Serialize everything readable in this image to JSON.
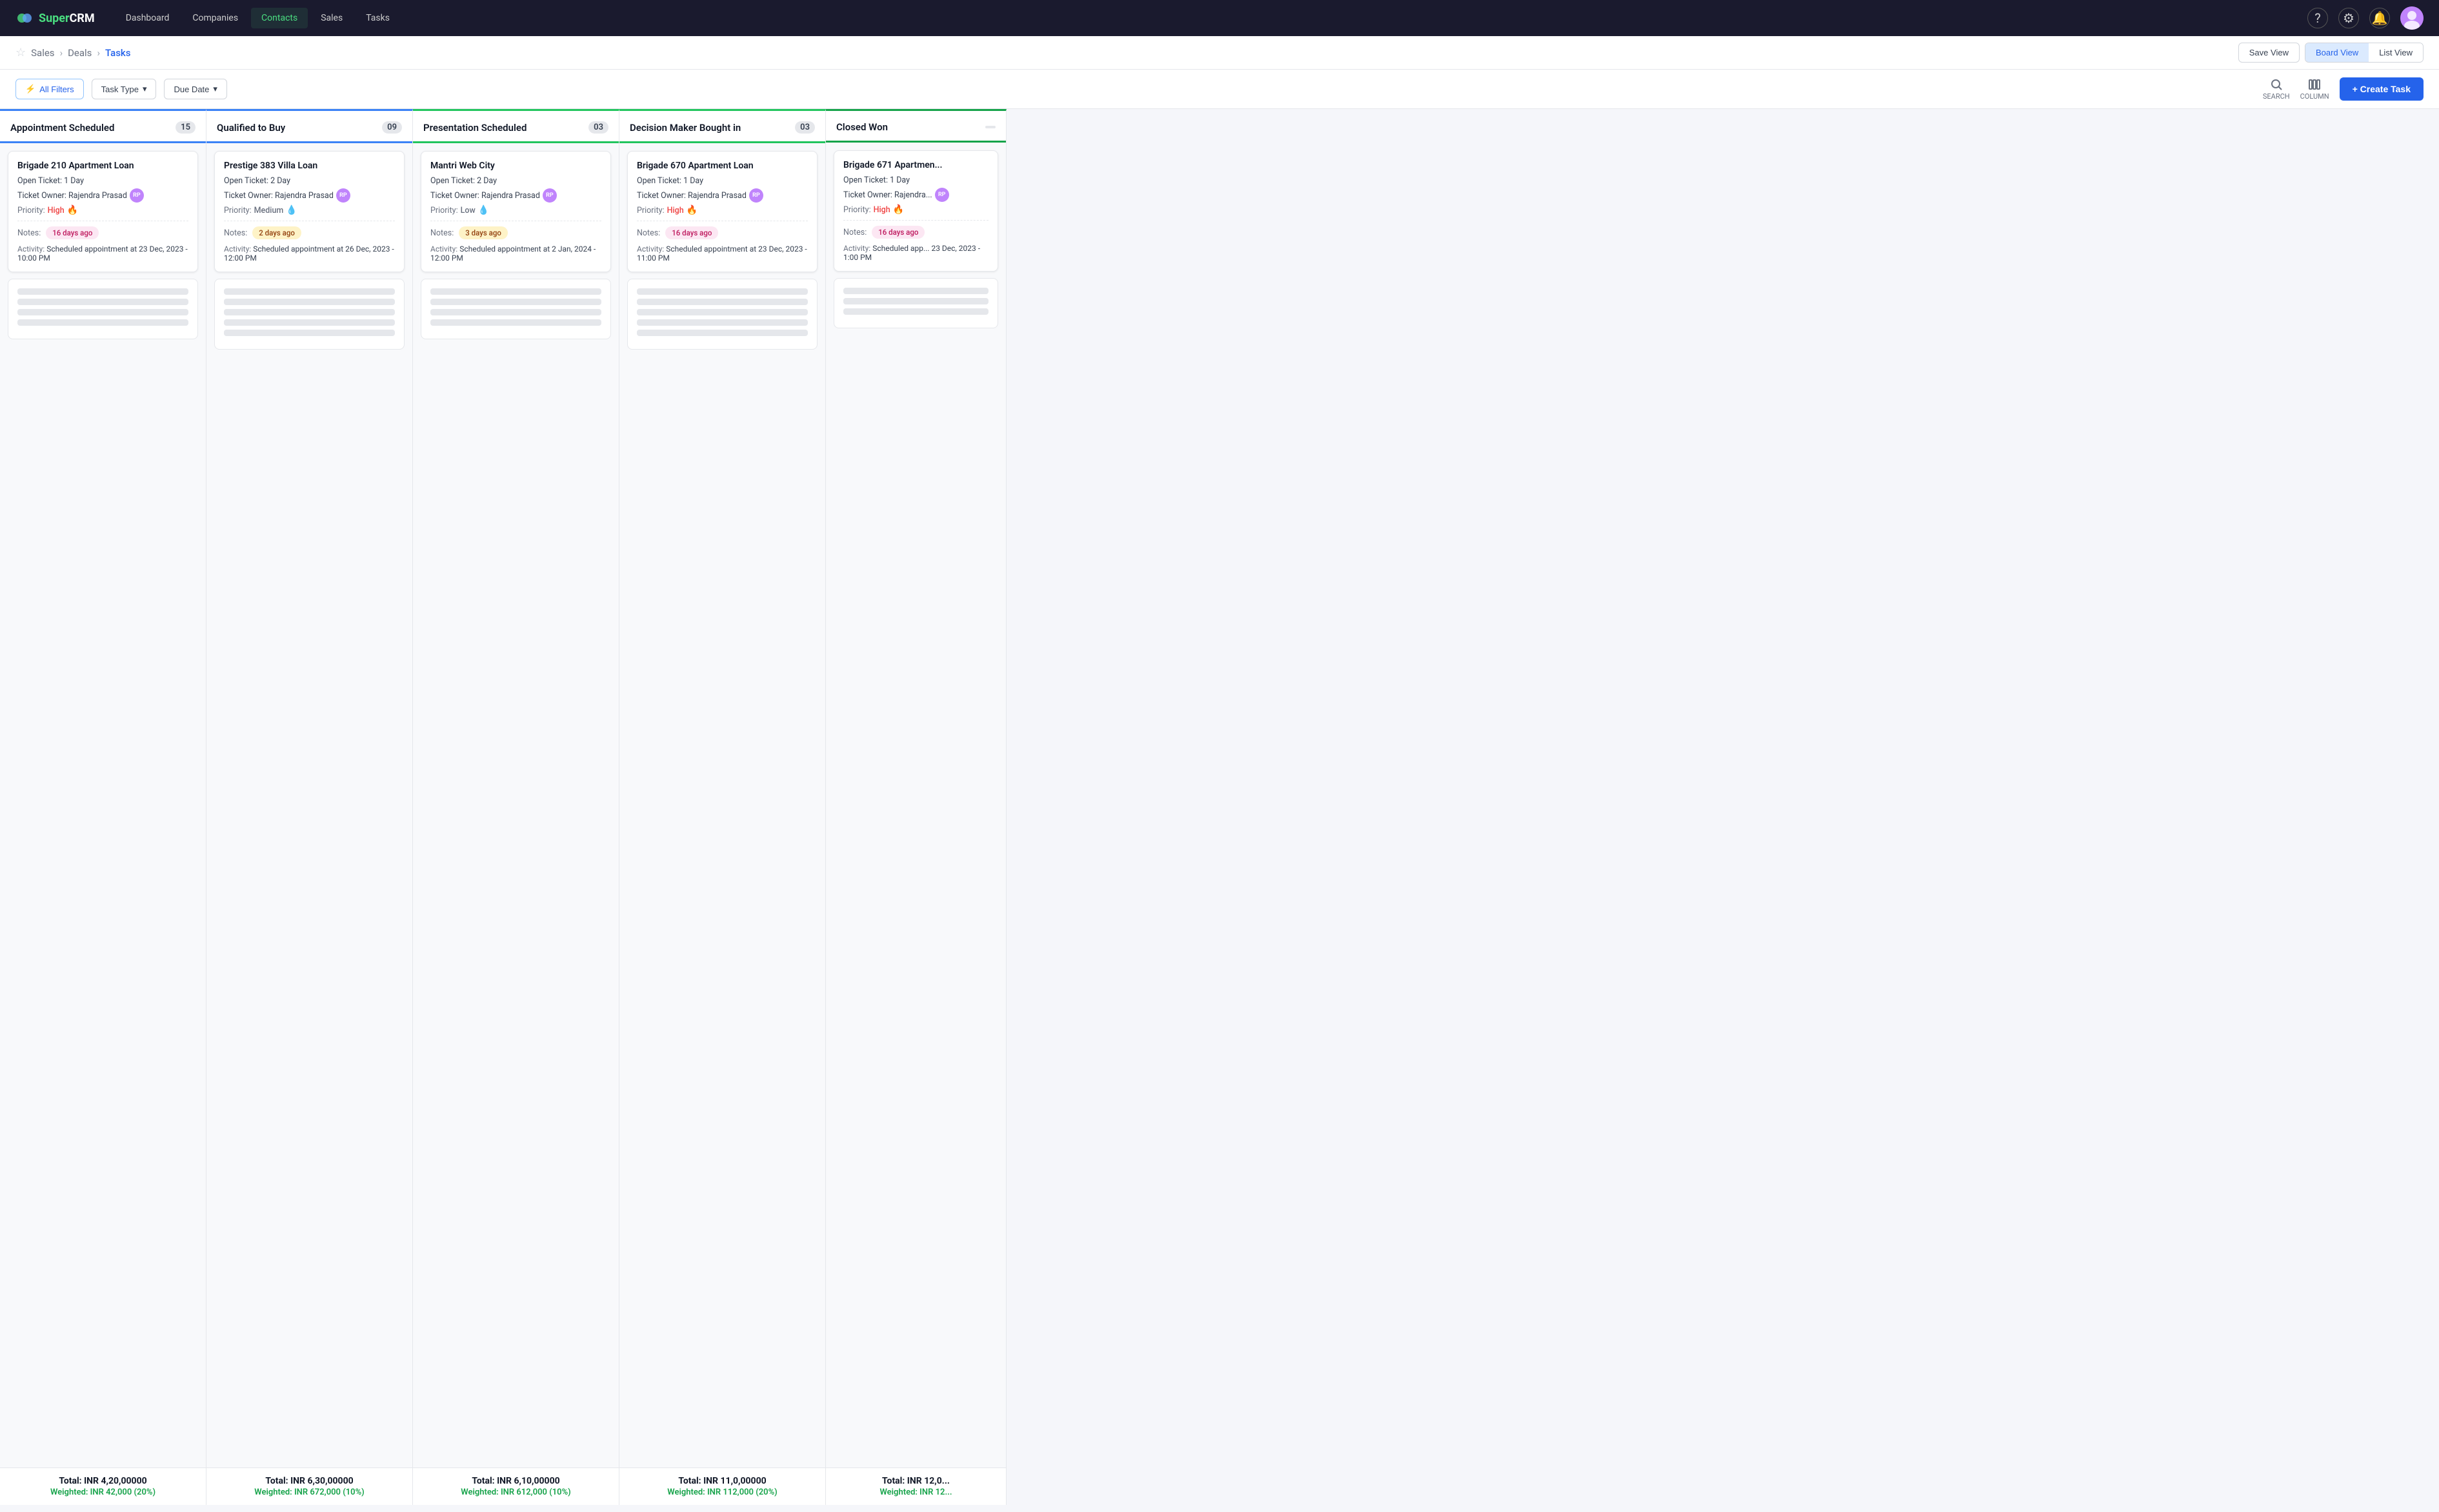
{
  "app": {
    "name": "SuperCRM",
    "logo_text_super": "Super",
    "logo_text_crm": "CRM"
  },
  "topnav": {
    "links": [
      {
        "label": "Dashboard",
        "active": false
      },
      {
        "label": "Companies",
        "active": false
      },
      {
        "label": "Contacts",
        "active": true
      },
      {
        "label": "Sales",
        "active": false
      },
      {
        "label": "Tasks",
        "active": false
      }
    ],
    "icons": {
      "help": "?",
      "settings": "⚙",
      "notifications": "🔔"
    }
  },
  "breadcrumb": {
    "star": "☆",
    "items": [
      {
        "label": "Sales",
        "active": false
      },
      {
        "label": "Deals",
        "active": false
      },
      {
        "label": "Tasks",
        "active": true
      }
    ]
  },
  "view_buttons": {
    "save_view": "Save View",
    "board_view": "Board View",
    "list_view": "List View"
  },
  "filters": {
    "all_filters": "All Filters",
    "task_type": "Task Type",
    "due_date": "Due Date",
    "search_label": "SEARCH",
    "column_label": "COLUMN",
    "create_task": "+ Create Task"
  },
  "columns": [
    {
      "id": "appointment-scheduled",
      "title": "Appointment Scheduled",
      "count": "15",
      "accent_color": "#3b82f6",
      "footer_total": "Total: INR 4,20,00000",
      "footer_weighted": "Weighted: INR 42,000 (20%)",
      "card": {
        "title": "Brigade 210 Apartment  Loan",
        "open_ticket": "Open Ticket: 1 Day",
        "owner": "Ticket Owner: Rajendra Prasad",
        "priority_label": "Priority:",
        "priority_value": "High",
        "priority_class": "high",
        "priority_emoji": "🔥",
        "notes_label": "Notes:",
        "notes_badge": "16 days ago",
        "notes_badge_class": "old",
        "activity_label": "Activity:",
        "activity_value": "Scheduled appointment at 23 Dec, 2023 - 10:00 PM"
      }
    },
    {
      "id": "qualified-to-buy",
      "title": "Qualified to Buy",
      "count": "09",
      "accent_color": "#3b82f6",
      "footer_total": "Total: INR 6,30,00000",
      "footer_weighted": "Weighted: INR 672,000 (10%)",
      "card": {
        "title": "Prestige 383 Villa Loan",
        "open_ticket": "Open Ticket: 2 Day",
        "owner": "Ticket Owner: Rajendra Prasad",
        "priority_label": "Priority:",
        "priority_value": "Medium",
        "priority_class": "medium",
        "priority_emoji": "💧",
        "notes_label": "Notes:",
        "notes_badge": "2 days ago",
        "notes_badge_class": "recent",
        "activity_label": "Activity:",
        "activity_value": "Scheduled appointment at 26 Dec, 2023 - 12:00 PM"
      }
    },
    {
      "id": "presentation-scheduled",
      "title": "Presentation Scheduled",
      "count": "03",
      "accent_color": "#22c55e",
      "footer_total": "Total: INR 6,10,00000",
      "footer_weighted": "Weighted: INR 612,000 (10%)",
      "card": {
        "title": "Mantri Web City",
        "open_ticket": "Open Ticket: 2 Day",
        "owner": "Ticket Owner: Rajendra Prasad",
        "priority_label": "Priority:",
        "priority_value": "Low",
        "priority_class": "low",
        "priority_emoji": "💧",
        "notes_label": "Notes:",
        "notes_badge": "3 days ago",
        "notes_badge_class": "recent",
        "activity_label": "Activity:",
        "activity_value": "Scheduled appointment at 2 Jan, 2024 - 12:00 PM"
      }
    },
    {
      "id": "decision-maker-bought-in",
      "title": "Decision Maker Bought in",
      "count": "03",
      "accent_color": "#22c55e",
      "footer_total": "Total: INR 11,0,00000",
      "footer_weighted": "Weighted: INR 112,000 (20%)",
      "card": {
        "title": "Brigade 670 Apartment  Loan",
        "open_ticket": "Open Ticket: 1 Day",
        "owner": "Ticket Owner: Rajendra Prasad",
        "priority_label": "Priority:",
        "priority_value": "High",
        "priority_class": "high",
        "priority_emoji": "🔥",
        "notes_label": "Notes:",
        "notes_badge": "16 days ago",
        "notes_badge_class": "old",
        "activity_label": "Activity:",
        "activity_value": "Scheduled appointment at 23 Dec, 2023 - 11:00 PM"
      }
    },
    {
      "id": "closed-won",
      "title": "Closed Won",
      "count": "",
      "accent_color": "#16a34a",
      "footer_total": "Total: INR 12,0...",
      "footer_weighted": "Weighted: INR 12...",
      "card": {
        "title": "Brigade 671 Apartmen...",
        "open_ticket": "Open Ticket: 1 Day",
        "owner": "Ticket Owner: Rajendra...",
        "priority_label": "Priority:",
        "priority_value": "High",
        "priority_class": "high",
        "priority_emoji": "🔥",
        "notes_label": "Notes:",
        "notes_badge": "16 days ago",
        "notes_badge_class": "old",
        "activity_label": "Activity:",
        "activity_value": "Scheduled app... 23 Dec, 2023 - 1:00 PM"
      }
    }
  ]
}
